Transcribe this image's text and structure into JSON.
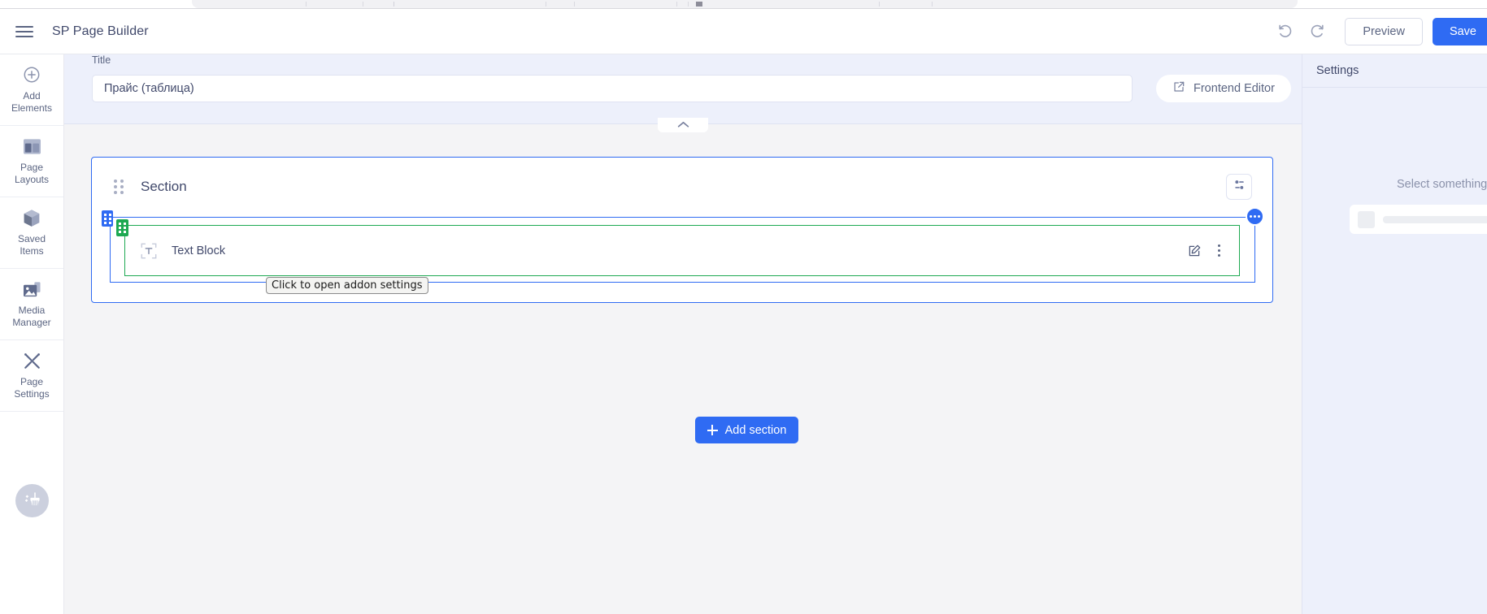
{
  "header": {
    "menu_icon": "hamburger-icon",
    "app_title": "SP Page Builder",
    "undo_icon": "undo-icon",
    "redo_icon": "redo-icon",
    "preview_label": "Preview",
    "save_label": "Save",
    "save_color": "#2f6bf3"
  },
  "sidebar": {
    "items": [
      {
        "label": "Add\nElements",
        "label_line1": "Add",
        "label_line2": "Elements",
        "icon": "plus-circle-icon"
      },
      {
        "label": "Page Layouts",
        "label_line1": "Page",
        "label_line2": "Layouts",
        "icon": "layout-icon"
      },
      {
        "label": "Saved Items",
        "label_line1": "Saved",
        "label_line2": "Items",
        "icon": "cube-icon"
      },
      {
        "label": "Media Manager",
        "label_line1": "Media",
        "label_line2": "Manager",
        "icon": "image-icon"
      },
      {
        "label": "Page Settings",
        "label_line1": "Page",
        "label_line2": "Settings",
        "icon": "tools-icon"
      }
    ],
    "clean_button_icon": "broom-icon"
  },
  "title_bar": {
    "label": "Title",
    "value": "Прайс (таблица)",
    "placeholder": "Title",
    "frontend_editor_label": "Frontend Editor",
    "frontend_editor_icon": "external-link-icon",
    "collapse_icon": "chevron-up-icon"
  },
  "canvas": {
    "section": {
      "title": "Section",
      "drag_handle_icon": "drag-dots-icon",
      "settings_icon": "sliders-icon",
      "border_color": "#2f6bf3"
    },
    "column": {
      "handle_icon": "drag-dots-icon",
      "badge_icon": "ellipsis-icon",
      "border_color": "#2f6bf3"
    },
    "addon": {
      "name": "Text Block",
      "icon": "text-block-icon",
      "handle_icon": "drag-dots-icon",
      "edit_icon": "pencil-square-icon",
      "more_icon": "vertical-ellipsis-icon",
      "border_color": "#1ea952"
    },
    "tooltip": "Click to open addon settings",
    "add_section_label": "Add section",
    "add_section_icon": "plus-icon"
  },
  "settings_panel": {
    "title": "Settings",
    "empty_text": "Select something to edit"
  }
}
